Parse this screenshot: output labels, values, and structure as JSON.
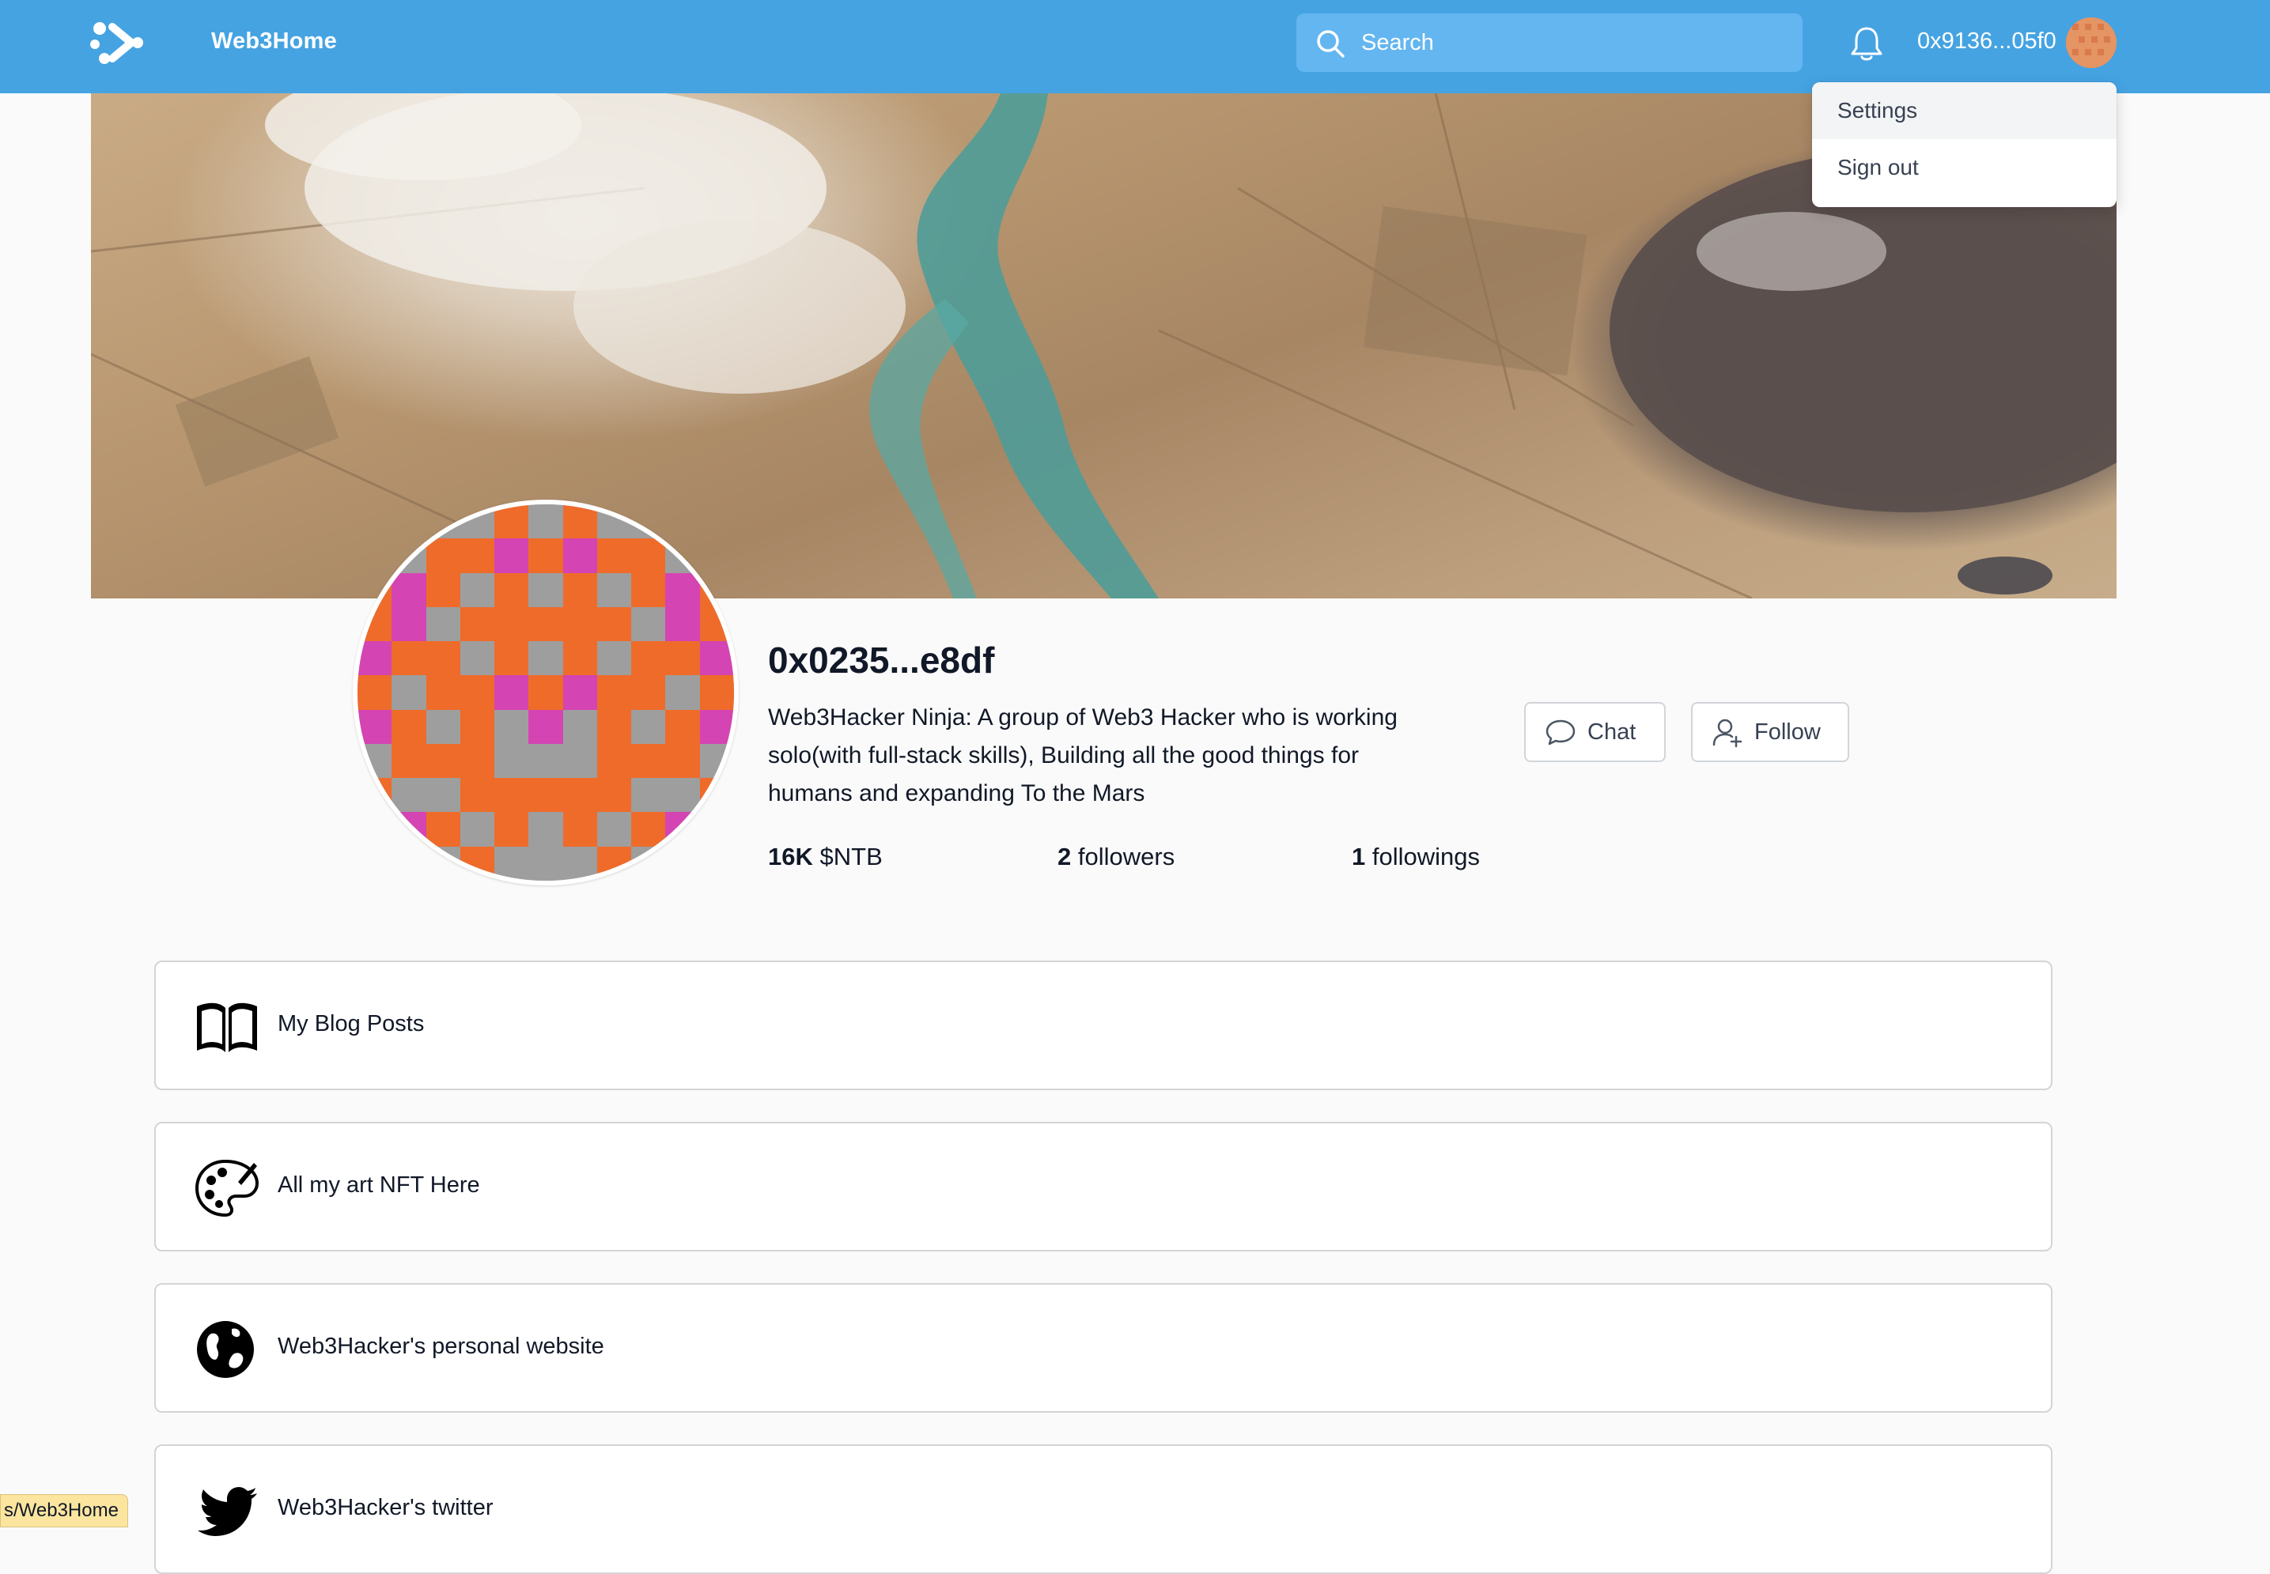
{
  "nav": {
    "brand": "Web3Home",
    "search_placeholder": "Search",
    "address": "0x9136...05f0"
  },
  "dropdown": {
    "items": [
      "Settings",
      "Sign out"
    ]
  },
  "profile": {
    "name": "0x0235...e8df",
    "bio": "Web3Hacker Ninja: A group of Web3 Hacker who is working solo(with full-stack skills), Building all the good things for humans and expanding To the Mars",
    "stats": {
      "tokens_value": "16K",
      "tokens_label": "$NTB",
      "followers_value": "2",
      "followers_label": "followers",
      "followings_value": "1",
      "followings_label": "followings"
    },
    "buttons": {
      "chat": "Chat",
      "follow": "Follow"
    }
  },
  "links": [
    {
      "label": "My Blog Posts",
      "icon": "book-icon"
    },
    {
      "label": "All my art NFT Here",
      "icon": "palette-icon"
    },
    {
      "label": "Web3Hacker's personal website",
      "icon": "globe-icon"
    },
    {
      "label": "Web3Hacker's twitter",
      "icon": "twitter-bird-icon"
    }
  ],
  "status_bar": {
    "url": "s/Web3Home"
  },
  "colors": {
    "nav_bg": "#45a3e2",
    "avatar_orange": "#ef6b2a",
    "avatar_magenta": "#d444b3",
    "avatar_gray": "#9e9e9e"
  }
}
